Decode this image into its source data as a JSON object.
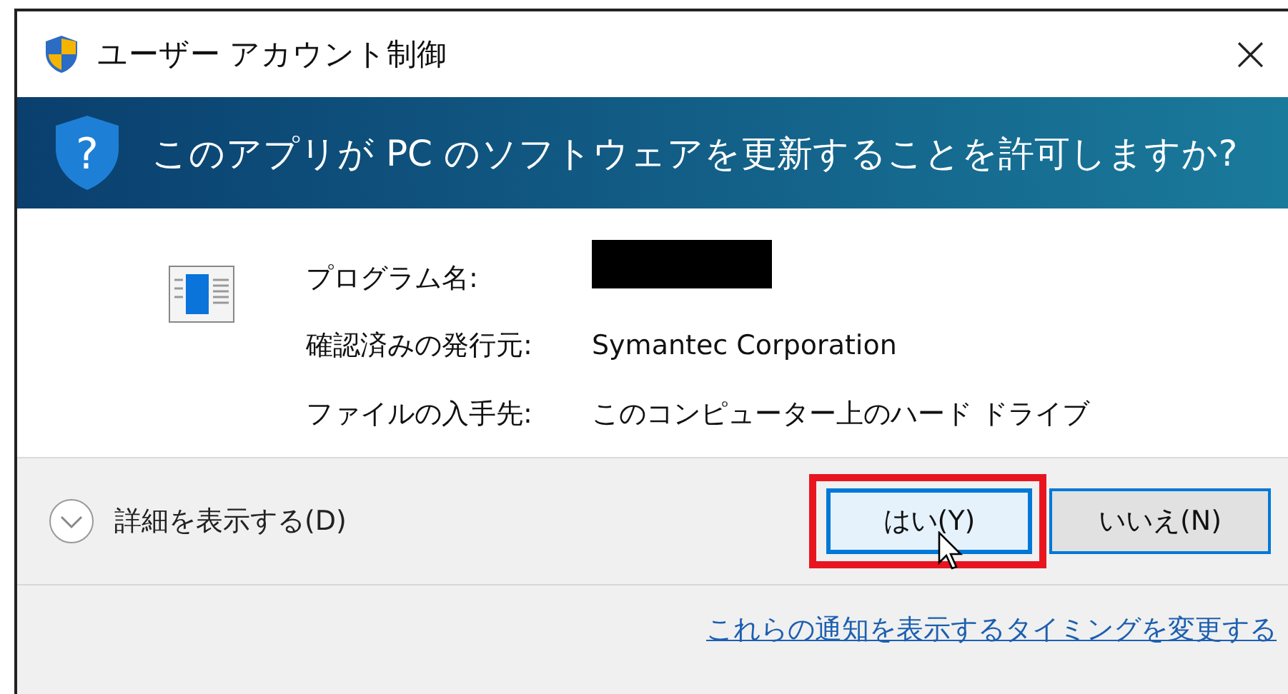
{
  "window": {
    "title": "ユーザー アカウント制御",
    "close": "×"
  },
  "banner": {
    "icon_glyph": "?",
    "question": "このアプリが PC のソフトウェアを更新することを許可しますか?"
  },
  "details": [
    {
      "label": "プログラム名:",
      "redacted": true
    },
    {
      "label": "確認済みの発行元:",
      "value": "Symantec Corporation",
      "redacted": false
    },
    {
      "label": "ファイルの入手先:",
      "value": "このコンピューター上のハード ドライブ",
      "redacted": false
    }
  ],
  "expander": {
    "label": "詳細を表示する(D)",
    "expanded": false
  },
  "buttons": [
    {
      "label": "はい(Y)",
      "focused": true,
      "highlighted": true,
      "hovered": true
    },
    {
      "label": "いいえ(N)",
      "focused": false,
      "highlighted": false,
      "hovered": false
    }
  ],
  "link": "これらの通知を表示するタイミングを変更する"
}
